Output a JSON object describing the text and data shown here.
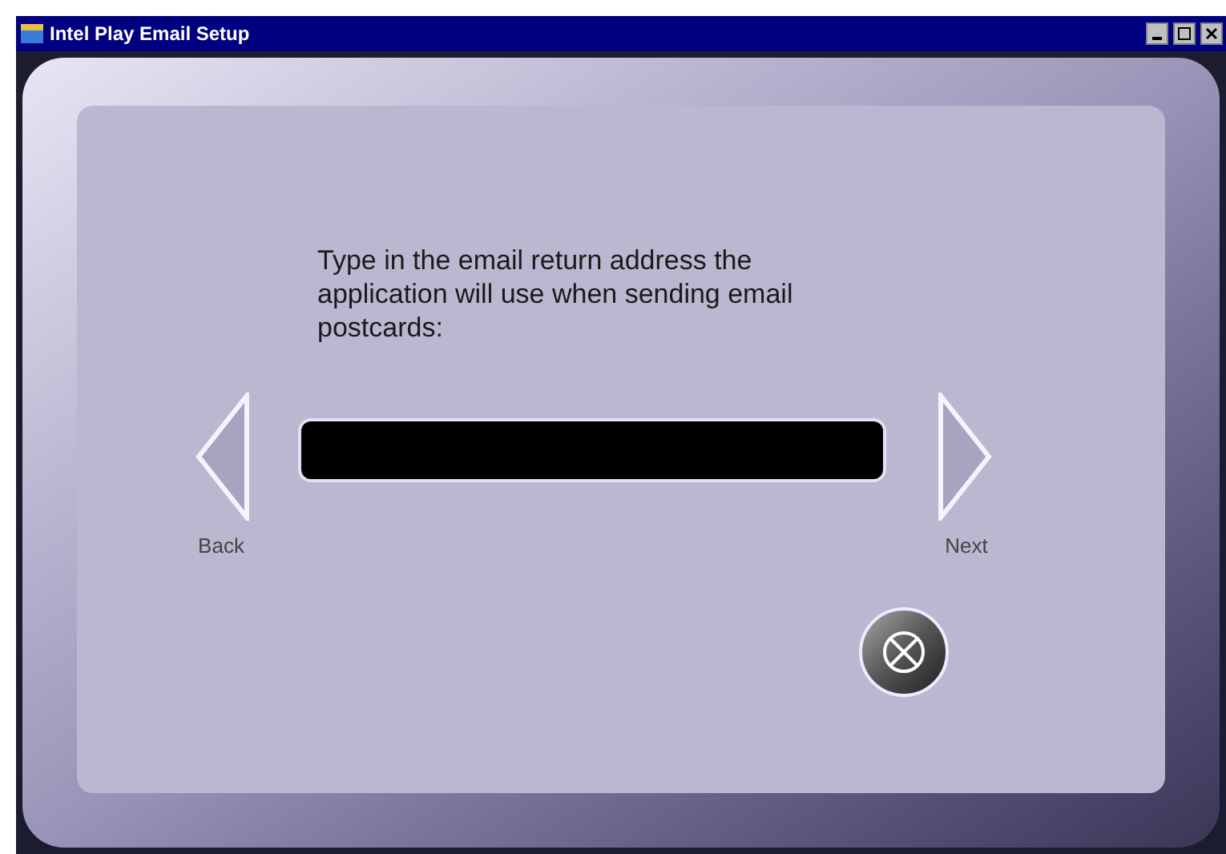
{
  "window": {
    "title": "Intel Play Email Setup"
  },
  "prompt": "Type in the email return address the application will use when sending email postcards:",
  "back_button": {
    "label": "Back"
  },
  "next_button": {
    "label": "Next"
  }
}
